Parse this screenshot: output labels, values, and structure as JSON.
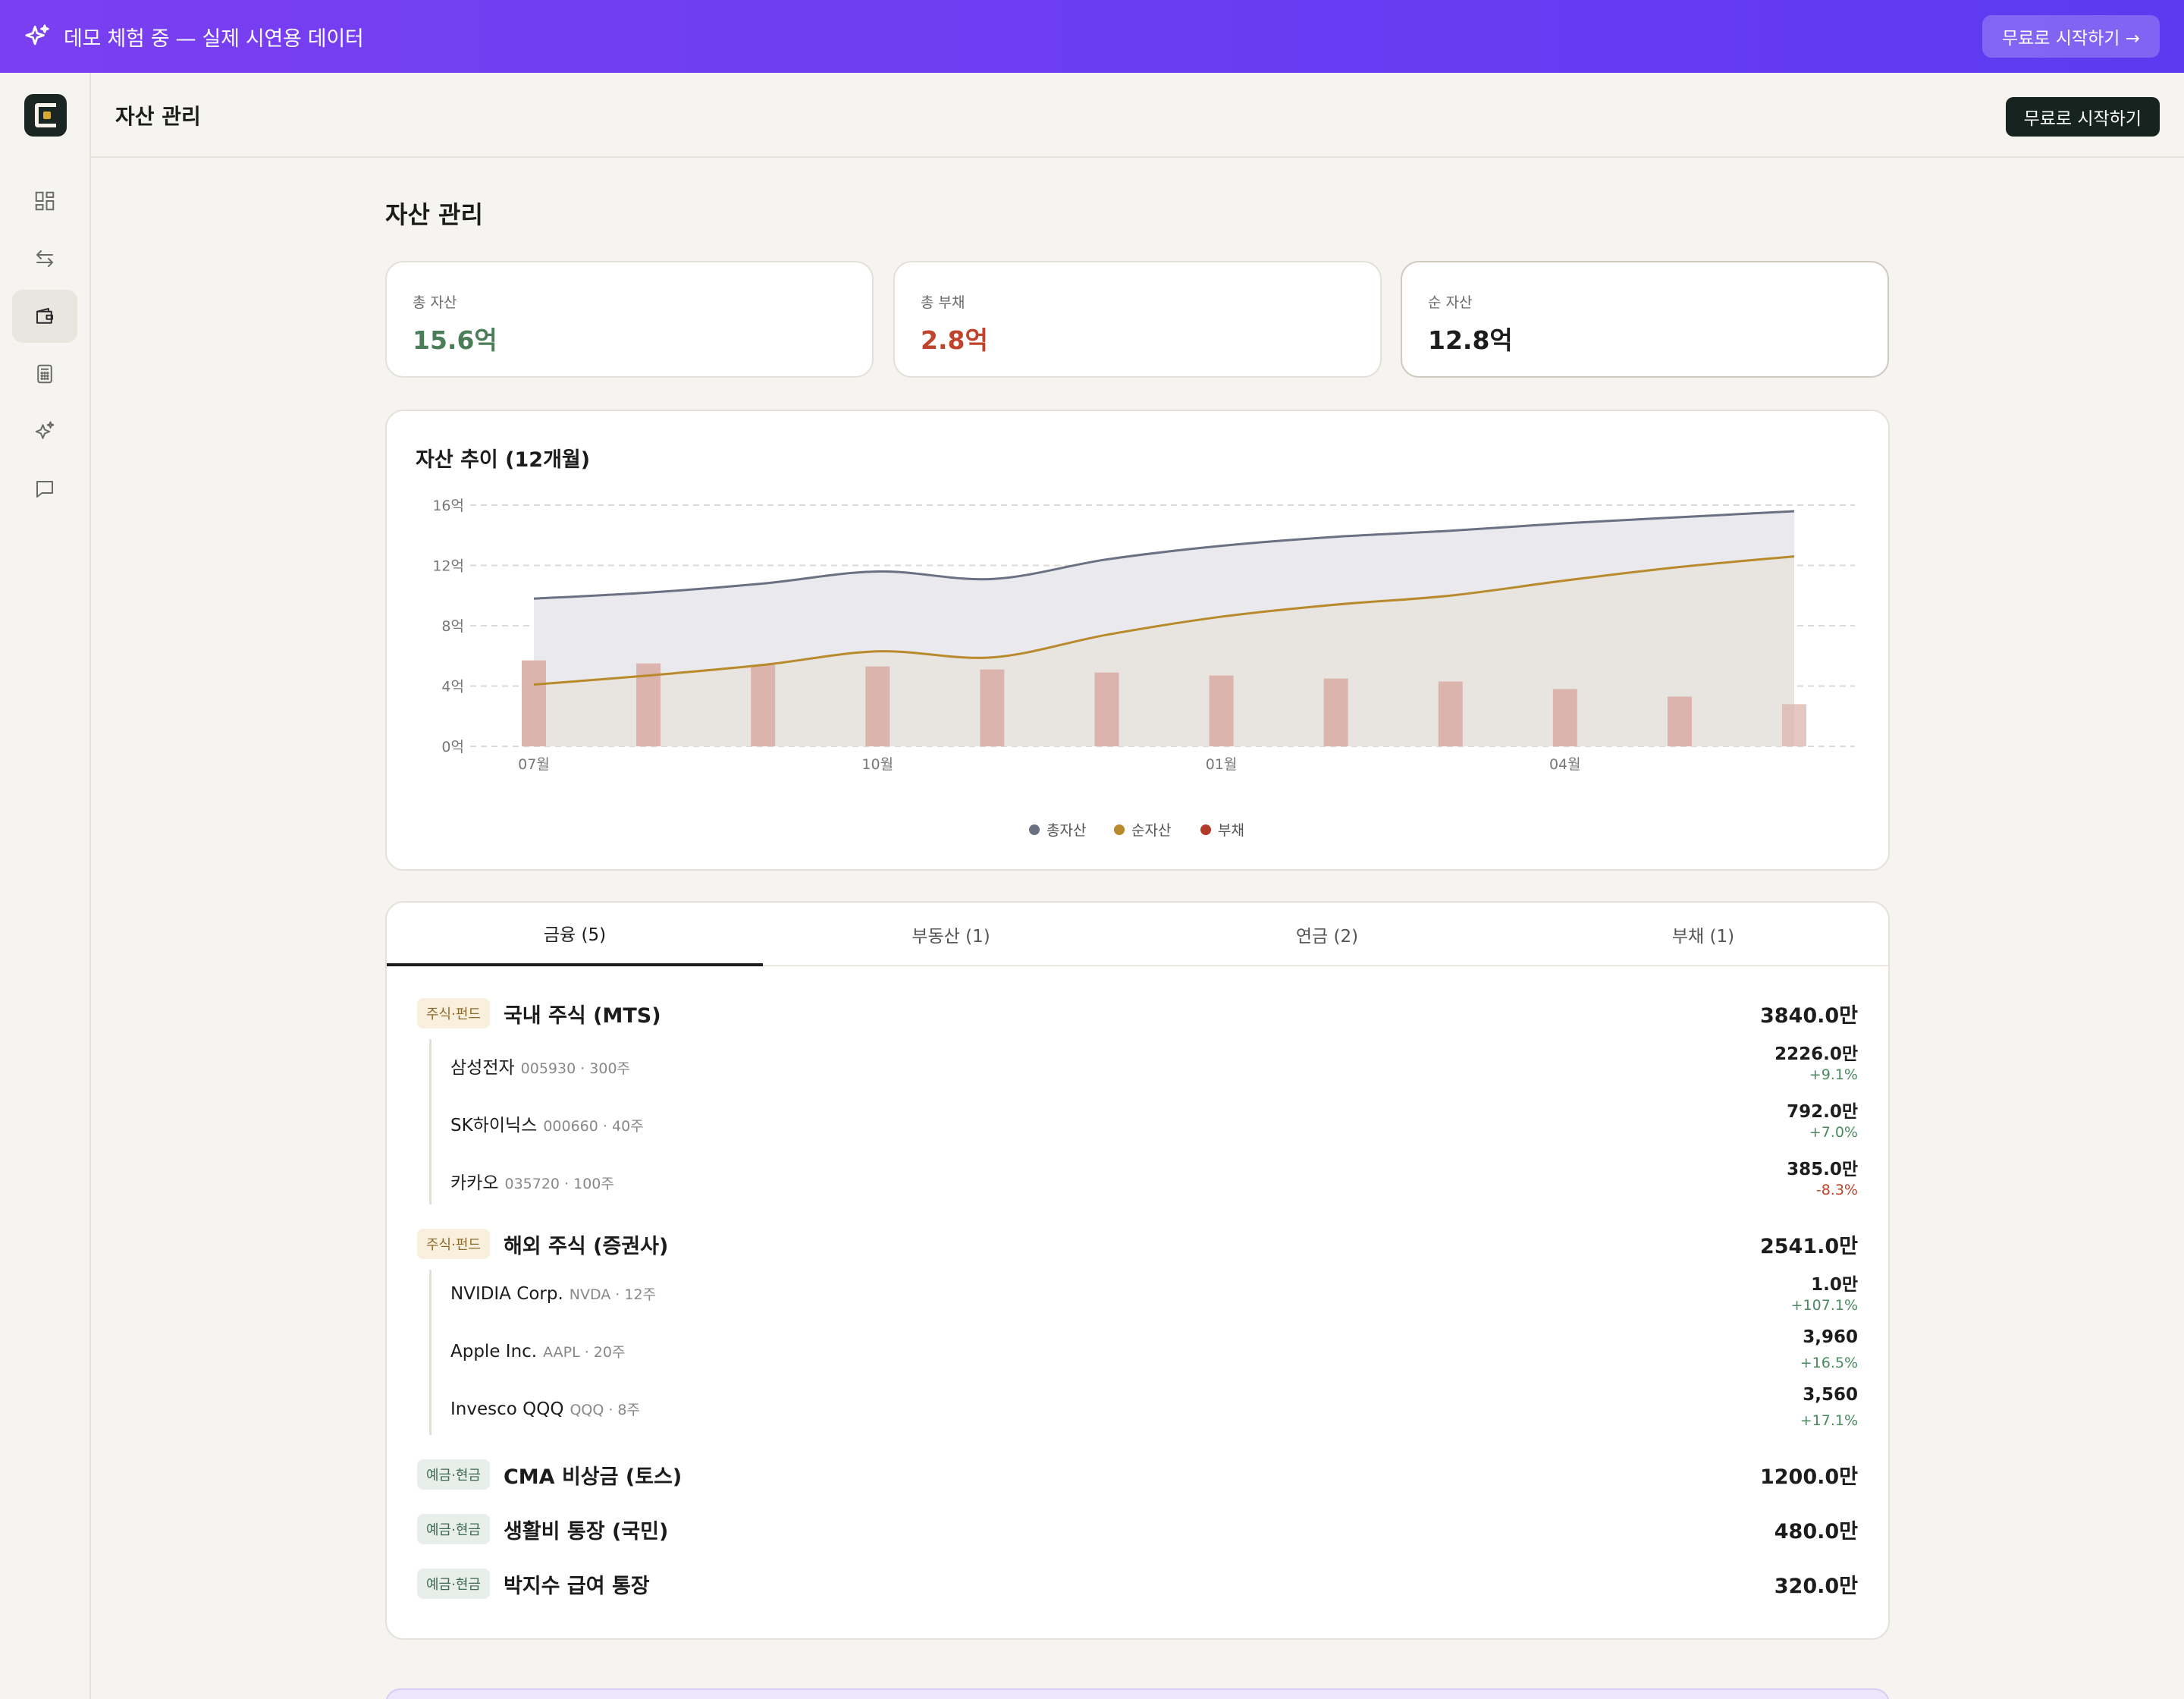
{
  "banner": {
    "text": "데모 체험 중 — 실제 시연용 데이터",
    "button": "무료로 시작하기 →"
  },
  "topbar": {
    "title": "자산 관리",
    "cta": "무료로 시작하기"
  },
  "sidebar": {
    "items": [
      "dashboard-icon",
      "transfer-icon",
      "wallet-icon",
      "calculator-icon",
      "sparkle-icon",
      "chat-icon"
    ],
    "active": 2
  },
  "page": {
    "title": "자산 관리"
  },
  "kpis": [
    {
      "label": "총 자산",
      "value": "15.6억",
      "color": "#4a7d58"
    },
    {
      "label": "총 부채",
      "value": "2.8억",
      "color": "#c0432c"
    },
    {
      "label": "순 자산",
      "value": "12.8억",
      "color": "#1c1c1c"
    }
  ],
  "chart": {
    "title": "자산 추이 (12개월)"
  },
  "chart_data": {
    "type": "line",
    "title": "자산 추이 (12개월)",
    "y_ticks": [
      "0억",
      "4억",
      "8억",
      "12억",
      "16억"
    ],
    "ylim": [
      0,
      16
    ],
    "x_tick_labels": [
      "07월",
      "10월",
      "01월",
      "04월"
    ],
    "x_tick_indices": [
      0,
      3,
      6,
      9
    ],
    "grid": true,
    "legend_position": "bottom",
    "series": [
      {
        "name": "총자산",
        "type": "area",
        "color": "#6b7082",
        "values": [
          9.8,
          10.2,
          10.8,
          11.6,
          11.1,
          12.4,
          13.3,
          13.9,
          14.3,
          14.8,
          15.2,
          15.6
        ]
      },
      {
        "name": "순자산",
        "type": "area",
        "color": "#b88a2c",
        "values": [
          4.1,
          4.7,
          5.4,
          6.3,
          5.9,
          7.4,
          8.6,
          9.4,
          10.0,
          11.0,
          11.9,
          12.6
        ]
      },
      {
        "name": "부채",
        "type": "bar",
        "color": "#b23a2b",
        "values": [
          5.7,
          5.5,
          5.4,
          5.3,
          5.1,
          4.9,
          4.7,
          4.5,
          4.3,
          3.8,
          3.3,
          2.8
        ]
      }
    ]
  },
  "tabs": [
    "금융 (5)",
    "부동산 (1)",
    "연금 (2)",
    "부채 (1)"
  ],
  "active_tab": 0,
  "groups": [
    {
      "badge": "주식·펀드",
      "badge_type": "stock",
      "name": "국내 주식 (MTS)",
      "amount": "3840.0만",
      "holdings": [
        {
          "name": "삼성전자",
          "meta": "005930 · 300주",
          "amount": "2226.0만",
          "change": "+9.1%",
          "dir": "pos"
        },
        {
          "name": "SK하이닉스",
          "meta": "000660 · 40주",
          "amount": "792.0만",
          "change": "+7.0%",
          "dir": "pos"
        },
        {
          "name": "카카오",
          "meta": "035720 · 100주",
          "amount": "385.0만",
          "change": "-8.3%",
          "dir": "neg"
        }
      ]
    },
    {
      "badge": "주식·펀드",
      "badge_type": "stock",
      "name": "해외 주식 (증권사)",
      "amount": "2541.0만",
      "holdings": [
        {
          "name": "NVIDIA Corp.",
          "meta": "NVDA · 12주",
          "amount": "1.0만",
          "change": "+107.1%",
          "dir": "pos"
        },
        {
          "name": "Apple Inc.",
          "meta": "AAPL · 20주",
          "amount": "3,960",
          "change": "+16.5%",
          "dir": "pos"
        },
        {
          "name": "Invesco QQQ",
          "meta": "QQQ · 8주",
          "amount": "3,560",
          "change": "+17.1%",
          "dir": "pos"
        }
      ]
    },
    {
      "badge": "예금·현금",
      "badge_type": "cash",
      "name": "CMA 비상금 (토스)",
      "amount": "1200.0만",
      "holdings": []
    },
    {
      "badge": "예금·현금",
      "badge_type": "cash",
      "name": "생활비 통장 (국민)",
      "amount": "480.0만",
      "holdings": []
    },
    {
      "badge": "예금·현금",
      "badge_type": "cash",
      "name": "박지수 급여 통장",
      "amount": "320.0만",
      "holdings": []
    }
  ]
}
